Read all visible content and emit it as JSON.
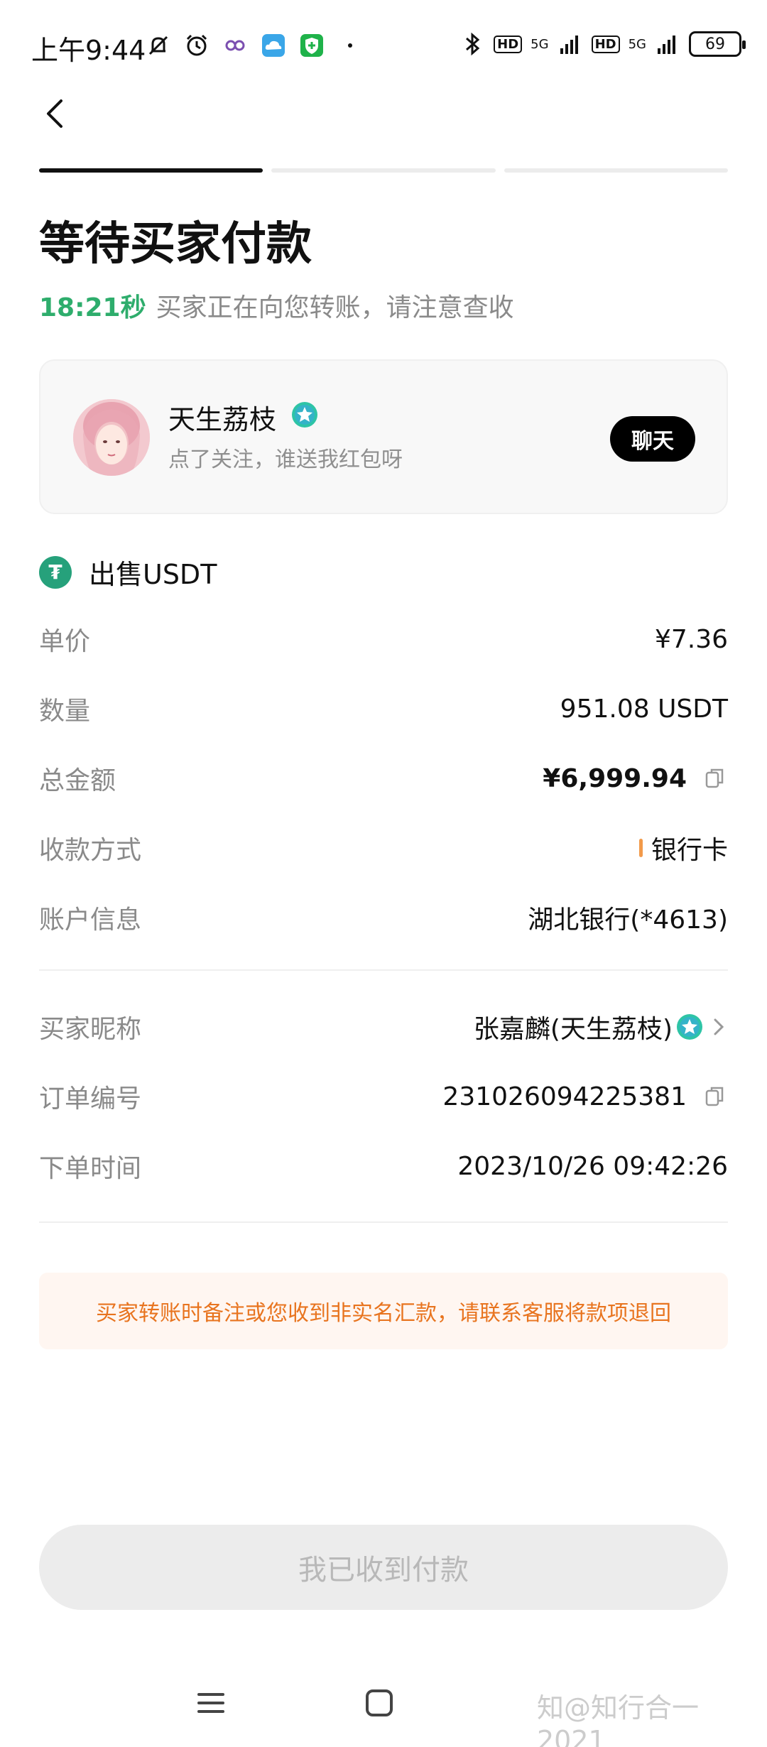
{
  "status": {
    "time": "上午9:44",
    "hd": "HD",
    "network": "5G",
    "battery": "69"
  },
  "progress": {
    "total_steps": 3,
    "current_step": 1
  },
  "page": {
    "title": "等待买家付款",
    "countdown": "18:21秒",
    "subtitle": "买家正在向您转账，请注意查收"
  },
  "seller": {
    "name": "天生荔枝",
    "bio": "点了关注，谁送我红包呀",
    "chat_label": "聊天"
  },
  "order": {
    "header": "出售USDT",
    "unit_price_label": "单价",
    "unit_price": "¥7.36",
    "quantity_label": "数量",
    "quantity": "951.08 USDT",
    "total_label": "总金额",
    "total": "¥6,999.94",
    "payment_method_label": "收款方式",
    "payment_method": "银行卡",
    "account_label": "账户信息",
    "account": "湖北银行(*4613)",
    "buyer_label": "买家昵称",
    "buyer": "张嘉麟(天生荔枝)",
    "order_no_label": "订单编号",
    "order_no": "231026094225381",
    "time_label": "下单时间",
    "time": "2023/10/26 09:42:26"
  },
  "notice": "买家转账时备注或您收到非实名汇款，请联系客服将款项退回",
  "confirm_button": "我已收到付款",
  "watermark": "知@知行合一2021",
  "colors": {
    "accent_green": "#2ead6c",
    "tether_green": "#26a17b",
    "notice_orange": "#e8741f",
    "notice_bg": "#fff6f1"
  }
}
